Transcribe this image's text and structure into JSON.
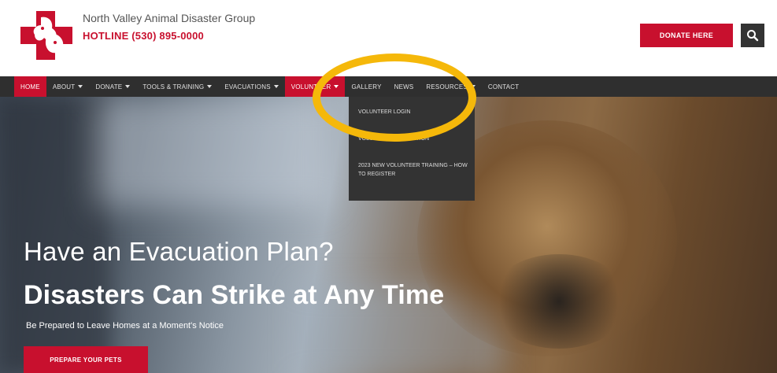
{
  "header": {
    "org_name": "North Valley Animal Disaster Group",
    "hotline": "HOTLINE (530) 895-0000",
    "donate_label": "DONATE HERE"
  },
  "nav": {
    "items": [
      {
        "label": "HOME",
        "has_caret": false
      },
      {
        "label": "ABOUT",
        "has_caret": true
      },
      {
        "label": "DONATE",
        "has_caret": true
      },
      {
        "label": "TOOLS & TRAINING",
        "has_caret": true
      },
      {
        "label": "EVACUATIONS",
        "has_caret": true
      },
      {
        "label": "VOLUNTEER",
        "has_caret": true
      },
      {
        "label": "GALLERY",
        "has_caret": false
      },
      {
        "label": "NEWS",
        "has_caret": false
      },
      {
        "label": "RESOURCES",
        "has_caret": true
      },
      {
        "label": "CONTACT",
        "has_caret": false
      }
    ]
  },
  "dropdown": {
    "items": [
      {
        "label": "VOLUNTEER LOGIN"
      },
      {
        "label": "VOLUNTEER APPLICATION"
      },
      {
        "label": "2023 NEW VOLUNTEER TRAINING – HOW TO REGISTER"
      }
    ]
  },
  "hero": {
    "line1": "Have an Evacuation Plan?",
    "line2": "Disasters Can Strike at Any Time",
    "line3": "Be Prepared to Leave Homes at a Moment's Notice",
    "button_label": "PREPARE YOUR PETS"
  },
  "colors": {
    "brand_red": "#c8102e",
    "nav_bg": "#2f2f2f",
    "highlight": "#f5b80a"
  },
  "icons": {
    "logo": "red-cross-animals-logo",
    "search": "search-icon",
    "caret": "caret-down-icon"
  }
}
